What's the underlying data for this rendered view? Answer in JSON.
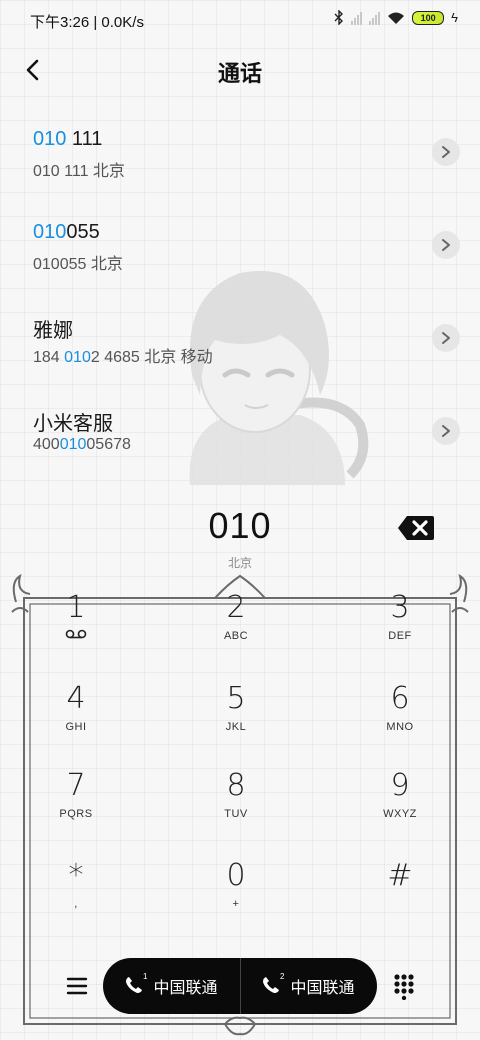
{
  "status_bar": {
    "time": "下午3:26 | 0.0K/s",
    "battery": "100",
    "icons": [
      "bluetooth-icon",
      "signal-icon",
      "signal-icon",
      "wifi-icon",
      "battery-icon",
      "charging-icon"
    ]
  },
  "header": {
    "title": "通话",
    "back_icon": "back-arrow-icon"
  },
  "results": [
    {
      "name_hl": "010",
      "name_rest": " 111",
      "detail_pre": "",
      "detail_hl": "",
      "detail_rest": "010 111 北京"
    },
    {
      "name_hl": "010",
      "name_rest": "055",
      "detail_pre": "",
      "detail_hl": "",
      "detail_rest": "010055 北京"
    },
    {
      "name_hl": "",
      "name_rest": "雅娜",
      "detail_pre": "184 ",
      "detail_hl": "010",
      "detail_rest": "2 4685 北京 移动"
    },
    {
      "name_hl": "",
      "name_rest": "小米客服",
      "detail_pre": "400",
      "detail_hl": "010",
      "detail_rest": "05678"
    }
  ],
  "dial": {
    "number": "010",
    "location": "北京",
    "delete_icon": "backspace-icon"
  },
  "keypad": [
    {
      "digit": "1",
      "letters": ""
    },
    {
      "digit": "2",
      "letters": "ABC"
    },
    {
      "digit": "3",
      "letters": "DEF"
    },
    {
      "digit": "4",
      "letters": "GHI"
    },
    {
      "digit": "5",
      "letters": "JKL"
    },
    {
      "digit": "6",
      "letters": "MNO"
    },
    {
      "digit": "7",
      "letters": "PQRS"
    },
    {
      "digit": "8",
      "letters": "TUV"
    },
    {
      "digit": "9",
      "letters": "WXYZ"
    },
    {
      "digit": "*",
      "letters": ","
    },
    {
      "digit": "0",
      "letters": "+"
    },
    {
      "digit": "#",
      "letters": ""
    }
  ],
  "bottom_bar": {
    "sim1_label": "中国联通",
    "sim2_label": "中国联通",
    "sim1_badge": "1",
    "sim2_badge": "2"
  },
  "colors": {
    "highlight": "#1a8fe0",
    "call_pill": "#0a0a0a"
  }
}
